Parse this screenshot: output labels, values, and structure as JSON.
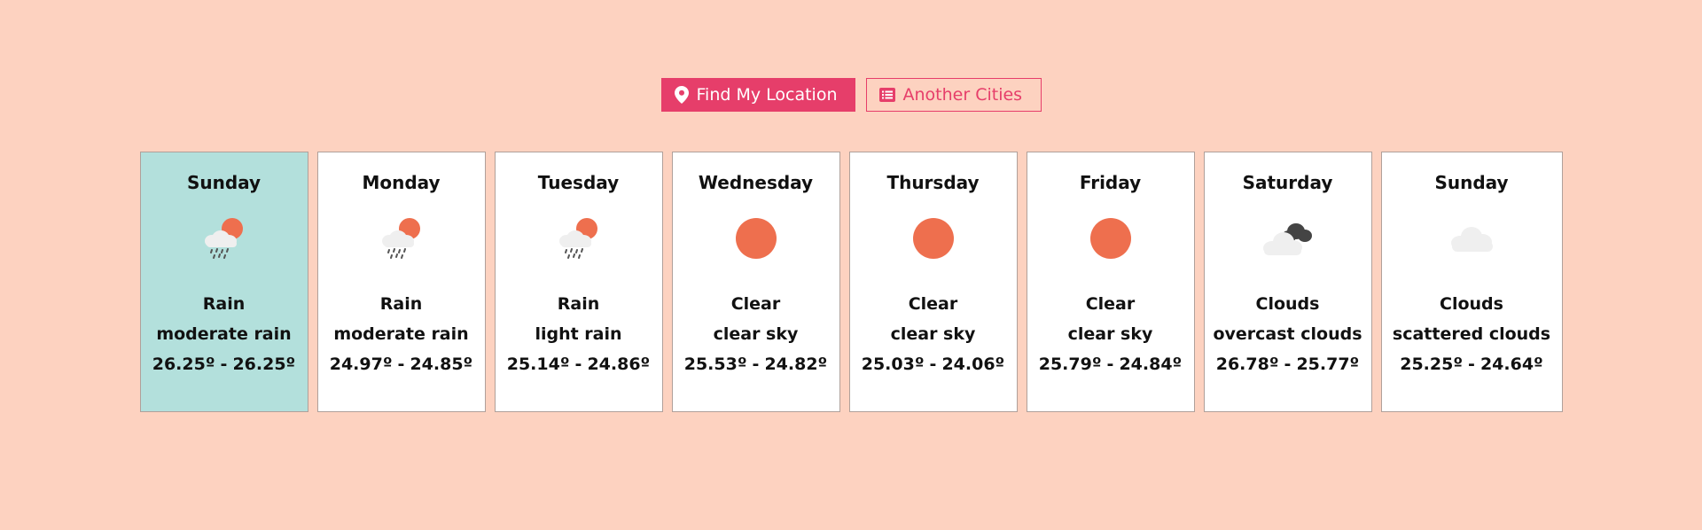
{
  "buttons": {
    "find_location": "Find My Location",
    "another_cities": "Another Cities"
  },
  "colors": {
    "background": "#fdd2c0",
    "accent": "#e63e6a",
    "active_card": "#b3e0dc",
    "sun": "#ee6f4e"
  },
  "forecast": [
    {
      "day": "Sunday",
      "icon": "rain-sun-icon",
      "main": "Rain",
      "desc": "moderate rain",
      "max": "26.25º",
      "sep": "-",
      "min": "26.25º"
    },
    {
      "day": "Monday",
      "icon": "rain-sun-icon",
      "main": "Rain",
      "desc": "moderate rain",
      "max": "24.97º",
      "sep": "-",
      "min": "24.85º"
    },
    {
      "day": "Tuesday",
      "icon": "rain-sun-icon",
      "main": "Rain",
      "desc": "light rain",
      "max": "25.14º",
      "sep": "-",
      "min": "24.86º"
    },
    {
      "day": "Wednesday",
      "icon": "sun-icon",
      "main": "Clear",
      "desc": "clear sky",
      "max": "25.53º",
      "sep": "-",
      "min": "24.82º"
    },
    {
      "day": "Thursday",
      "icon": "sun-icon",
      "main": "Clear",
      "desc": "clear sky",
      "max": "25.03º",
      "sep": "-",
      "min": "24.06º"
    },
    {
      "day": "Friday",
      "icon": "sun-icon",
      "main": "Clear",
      "desc": "clear sky",
      "max": "25.79º",
      "sep": "-",
      "min": "24.84º"
    },
    {
      "day": "Saturday",
      "icon": "overcast-clouds-icon",
      "main": "Clouds",
      "desc": "overcast clouds",
      "max": "26.78º",
      "sep": "-",
      "min": "25.77º"
    },
    {
      "day": "Sunday",
      "icon": "cloud-icon",
      "main": "Clouds",
      "desc": "scattered clouds",
      "max": "25.25º",
      "sep": "-",
      "min": "24.64º"
    }
  ]
}
